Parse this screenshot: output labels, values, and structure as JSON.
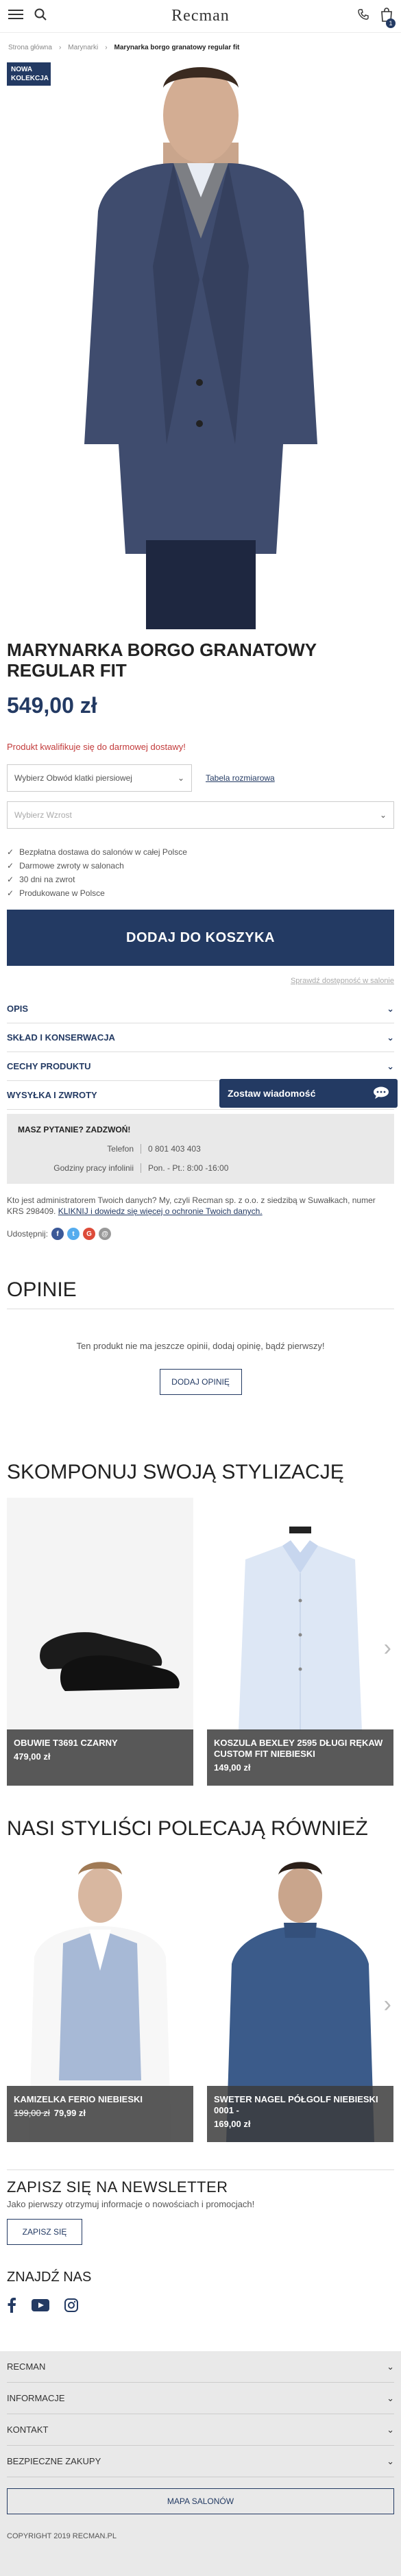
{
  "header": {
    "logo": "Recman",
    "cart_count": "1"
  },
  "breadcrumb": [
    "Strona główna",
    "Marynarki",
    "Marynarka borgo granatowy regular fit"
  ],
  "product": {
    "badge": "NOWA KOLEKCJA",
    "title": "MARYNARKA BORGO GRANATOWY REGULAR FIT",
    "price": "549,00 zł",
    "shipping_note": "Produkt kwalifikuje się do darmowej dostawy!",
    "size_select": "Wybierz Obwód klatki piersiowej",
    "size_table_link": "Tabela rozmiarowa",
    "height_select": "Wybierz Wzrost",
    "features": [
      "Bezpłatna dostawa do salonów w całej Polsce",
      "Darmowe zwroty w salonach",
      "30 dni na zwrot",
      "Produkowane w Polsce"
    ],
    "add_to_cart": "DODAJ DO KOSZYKA",
    "check_availability": "Sprawdź dostępność w salonie"
  },
  "accordion": [
    "OPIS",
    "SKŁAD I KONSERWACJA",
    "CECHY PRODUKTU",
    "WYSYŁKA I ZWROTY"
  ],
  "chat": {
    "label": "Zostaw wiadomość"
  },
  "contact": {
    "heading": "MASZ PYTANIE? ZADZWOŃ!",
    "phone_label": "Telefon",
    "phone_value": "0 801 403 403",
    "hours_label": "Godziny pracy infolinii",
    "hours_value": "Pon. - Pt.: 8:00 -16:00"
  },
  "gdpr": {
    "text": "Kto jest administratorem Twoich danych? My, czyli Recman sp. z o.o. z siedzibą w Suwałkach, numer KRS 298409.",
    "link": "KLIKNIJ i dowiedz się więcej o ochronie Twoich danych."
  },
  "share": {
    "label": "Udostępnij:"
  },
  "reviews": {
    "heading": "OPINIE",
    "empty": "Ten produkt nie ma jeszcze opinii, dodaj opinię, bądź pierwszy!",
    "button": "DODAJ OPINIĘ"
  },
  "styling": {
    "heading": "SKOMPONUJ SWOJĄ STYLIZACJĘ",
    "items": [
      {
        "name": "OBUWIE T3691 CZARNY",
        "price": "479,00 zł"
      },
      {
        "name": "KOSZULA BEXLEY 2595 DŁUGI RĘKAW CUSTOM FIT NIEBIESKI",
        "price": "149,00 zł"
      }
    ]
  },
  "recommend": {
    "heading": "NASI STYLIŚCI POLECAJĄ RÓWNIEŻ",
    "items": [
      {
        "name": "KAMIZELKA FERIO NIEBIESKI",
        "old_price": "199,00 zł",
        "price": "79,99 zł"
      },
      {
        "name": "SWETER NAGEL PÓŁGOLF NIEBIESKI 0001 -",
        "price": "169,00 zł"
      }
    ]
  },
  "newsletter": {
    "heading": "ZAPISZ SIĘ NA NEWSLETTER",
    "text": "Jako pierwszy otrzymuj informacje o nowościach i promocjach!",
    "button": "ZAPISZ SIĘ"
  },
  "follow": {
    "heading": "ZNAJDŹ NAS"
  },
  "footer": {
    "items": [
      "RECMAN",
      "INFORMACJE",
      "KONTAKT",
      "BEZPIECZNE ZAKUPY"
    ],
    "map_button": "MAPA SALONÓW",
    "copyright": "COPYRIGHT 2019 RECMAN.PL"
  },
  "colors": {
    "navy": "#233a63",
    "sale_red": "#c23b3b"
  }
}
